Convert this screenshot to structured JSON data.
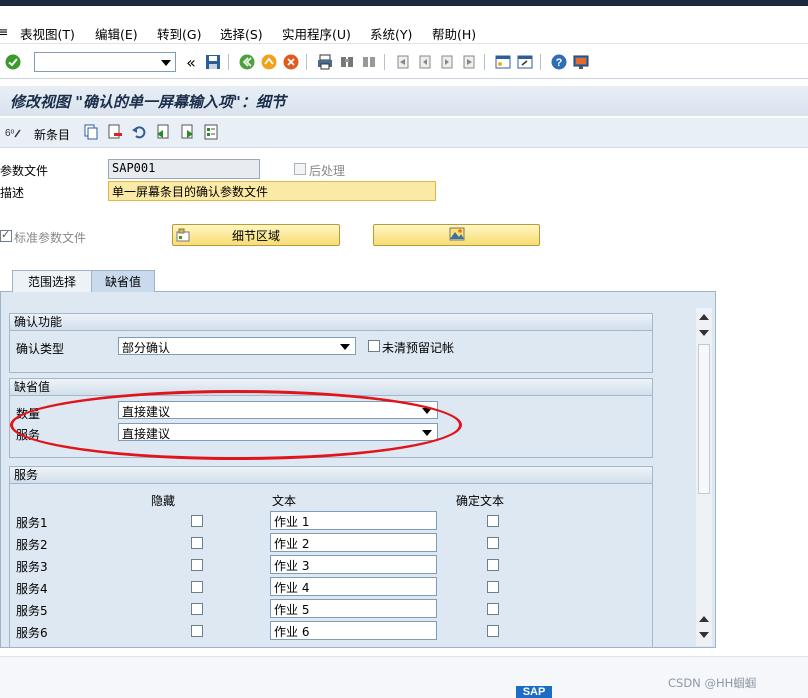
{
  "menu": {
    "items": [
      "表视图(T)",
      "编辑(E)",
      "转到(G)",
      "选择(S)",
      "实用程序(U)",
      "系统(Y)",
      "帮助(H)"
    ]
  },
  "toolbar": {
    "command_value": "",
    "back_glyph": "«"
  },
  "title": "修改视图 \"确认的单一屏幕输入项\"：细节",
  "app_toolbar": {
    "new_entries": "新条目"
  },
  "header": {
    "profile_label": "参数文件",
    "profile_value": "SAP001",
    "postproc_label": "后处理",
    "desc_label": "描述",
    "desc_value": "单一屏幕条目的确认参数文件",
    "std_profile_label": "标准参数文件",
    "detail_btn": "细节区域"
  },
  "tabs": [
    {
      "label": "范围选择",
      "active": false
    },
    {
      "label": "缺省值",
      "active": true
    }
  ],
  "confirm_group": {
    "title": "确认功能",
    "type_label": "确认类型",
    "type_value": "部分确认",
    "uncleared_label": "未清预留记帐"
  },
  "defaults_group": {
    "title": "缺省值",
    "qty_label": "数量",
    "qty_value": "直接建议",
    "svc_label": "服务",
    "svc_value": "直接建议"
  },
  "services_group": {
    "title": "服务",
    "col_hidden": "隐藏",
    "col_text": "文本",
    "col_fixed": "确定文本",
    "rows": [
      {
        "label": "服务1",
        "text": "作业 1"
      },
      {
        "label": "服务2",
        "text": "作业 2"
      },
      {
        "label": "服务3",
        "text": "作业 3"
      },
      {
        "label": "服务4",
        "text": "作业 4"
      },
      {
        "label": "服务5",
        "text": "作业 5"
      },
      {
        "label": "服务6",
        "text": "作业 6"
      }
    ]
  },
  "footer": {
    "logo": "SAP",
    "watermark": "CSDN @HH蝈蝈"
  },
  "colors": {
    "title_text": "#1c2e4a",
    "highlight_ellipse": "#e0141a",
    "yellow_field": "#fbeaa6",
    "panel_bg": "#dde8f3"
  }
}
